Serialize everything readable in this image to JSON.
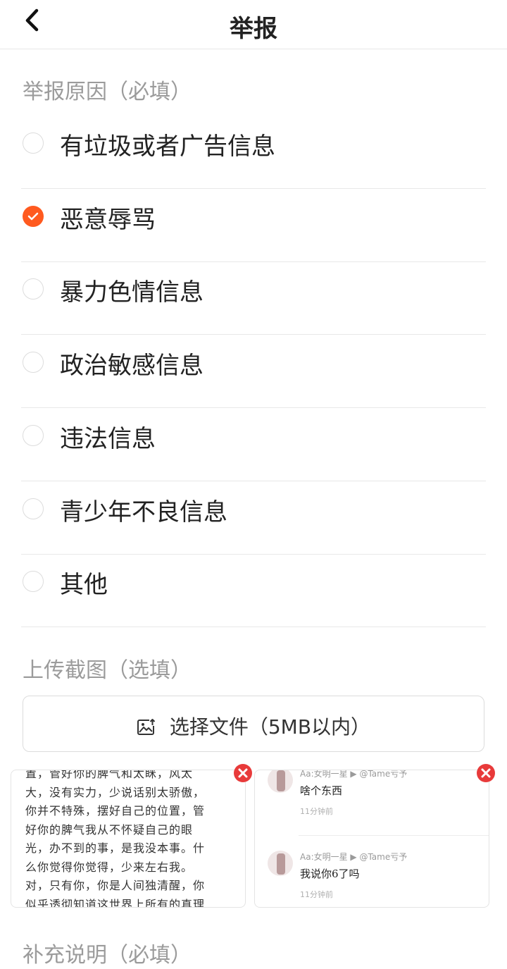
{
  "header": {
    "title": "举报",
    "back_icon": "chevron-left-icon"
  },
  "reason_section": {
    "label": "举报原因（必填）"
  },
  "reasons": [
    {
      "label": "有垃圾或者广告信息",
      "checked": false
    },
    {
      "label": "恶意辱骂",
      "checked": true
    },
    {
      "label": "暴力色情信息",
      "checked": false
    },
    {
      "label": "政治敏感信息",
      "checked": false
    },
    {
      "label": "违法信息",
      "checked": false
    },
    {
      "label": "青少年不良信息",
      "checked": false
    },
    {
      "label": "其他",
      "checked": false
    }
  ],
  "upload_section": {
    "label": "上传截图（选填）",
    "button_label": "选择文件（5MB以内）",
    "button_icon": "image-upload-icon"
  },
  "screenshots": [
    {
      "lines": [
        "置，管好你的脾气和太眯，风太",
        "大，没有实力，少说话别太骄傲，",
        "你并不特殊，摆好自己的位置，管",
        "好你的脾气我从不怀疑自己的眼",
        "光，办不到的事，是我没本事。什",
        "么你觉得你觉得，少来左右我。",
        "对，只有你，你是人间独清醒，你",
        "似乎透彻知道这世界上所有的真理"
      ]
    },
    {
      "messages": [
        {
          "name": "Aa:女明一星 ▶ @Tame亏予",
          "text": "啥个东西",
          "time": "11分钟前"
        },
        {
          "name": "Aa:女明一星 ▶ @Tame亏予",
          "text": "我说你6了吗",
          "time": "11分钟前"
        }
      ]
    }
  ],
  "note_section": {
    "label": "补充说明（必填）"
  },
  "colors": {
    "accent": "#ff5a1f",
    "delete": "#e83a3a",
    "muted_text": "#9b9b9b"
  }
}
